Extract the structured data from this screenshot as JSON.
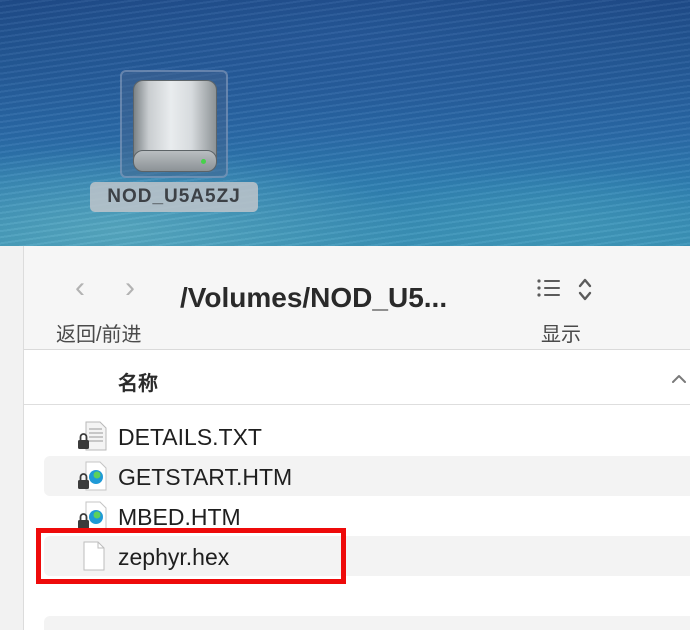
{
  "desktop": {
    "drive": {
      "label": "NOD_U5A5ZJ",
      "icon": "external-drive-icon"
    }
  },
  "toolbar": {
    "back_glyph": "‹",
    "forward_glyph": "›",
    "nav_label": "返回/前进",
    "path_title": "/Volumes/NOD_U5...",
    "view_label": "显示",
    "view_icon": "list-view-icon"
  },
  "columns": {
    "name_label": "名称",
    "sort_icon": "chevron-up-icon"
  },
  "files": [
    {
      "name": "DETAILS.TXT",
      "icon": "locked-text-document-icon"
    },
    {
      "name": "GETSTART.HTM",
      "icon": "locked-edge-html-icon"
    },
    {
      "name": "MBED.HTM",
      "icon": "locked-edge-html-icon"
    },
    {
      "name": "zephyr.hex",
      "icon": "blank-document-icon"
    }
  ],
  "annotation": {
    "highlight_color": "#ee0a0a",
    "highlighted_item": "zephyr.hex"
  }
}
